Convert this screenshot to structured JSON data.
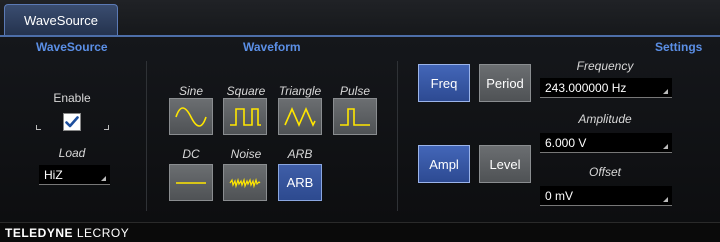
{
  "tab": {
    "label": "WaveSource"
  },
  "sections": {
    "wavesource": "WaveSource",
    "waveform": "Waveform",
    "settings": "Settings"
  },
  "enable": {
    "label": "Enable",
    "checked": true
  },
  "load": {
    "label": "Load",
    "value": "HiZ"
  },
  "waveforms": {
    "sine": "Sine",
    "square": "Square",
    "triangle": "Triangle",
    "pulse": "Pulse",
    "dc": "DC",
    "noise": "Noise",
    "arb": "ARB",
    "arb_button": "ARB"
  },
  "settings": {
    "freq_button": "Freq",
    "period_button": "Period",
    "ampl_button": "Ampl",
    "level_button": "Level",
    "frequency_label": "Frequency",
    "frequency_value": "243.000000 Hz",
    "amplitude_label": "Amplitude",
    "amplitude_value": "6.000 V",
    "offset_label": "Offset",
    "offset_value": "0 mV"
  },
  "footer": {
    "brand_bold": "TELEDYNE",
    "brand_rest": " LECROY"
  },
  "colors": {
    "accent": "#5b8fe6",
    "active_button": "#3f5ea8"
  }
}
